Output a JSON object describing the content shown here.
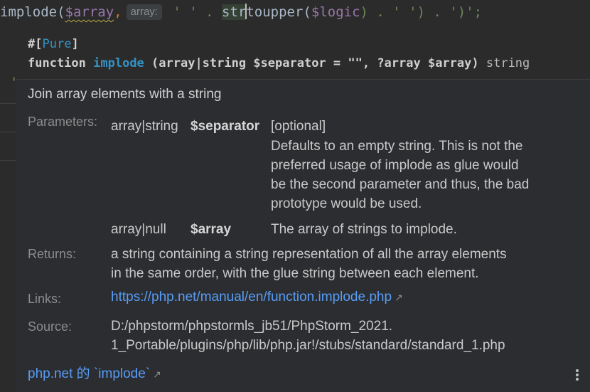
{
  "editor": {
    "fn": "implode(",
    "var_array": "$array",
    "comma": ",",
    "hint": "array:",
    "after_hint": " ' ' . ",
    "str_a": "str",
    "str_b": "toupper(",
    "var_logic": "$logic",
    "tail": ") . ' ') . ')';",
    "gutter_quote": "'"
  },
  "signature": {
    "attr_open": "#[",
    "attr_name": "Pure",
    "attr_close": "]",
    "keyword": "function",
    "name": "implode",
    "params": " (array|string $separator = \"\", ?array $array)",
    "return_type": "string"
  },
  "doc": {
    "description": "Join array elements with a string",
    "parameters_label": "Parameters:",
    "params": [
      {
        "type": "array|string",
        "name": "$separator",
        "tag": "[optional]",
        "desc": [
          "Defaults to an empty string. This is not the",
          "preferred usage of implode as glue would",
          "be the second parameter and thus, the bad",
          "prototype would be used."
        ]
      },
      {
        "type": "array|null",
        "name": "$array",
        "desc": [
          "The array of strings to implode."
        ]
      }
    ],
    "returns_label": "Returns:",
    "returns": [
      "a string containing a string representation of all the array elements",
      "in the same order, with the glue string between each element."
    ],
    "links_label": "Links:",
    "link": "https://php.net/manual/en/function.implode.php",
    "source_label": "Source:",
    "source": [
      "D:/phpstorm/phpstormls_jb51/PhpStorm_2021.",
      "1_Portable/plugins/php/lib/php.jar!/stubs/standard/standard_1.php"
    ],
    "footer_link": "php.net 的 `implode`",
    "arrow": "↗"
  }
}
